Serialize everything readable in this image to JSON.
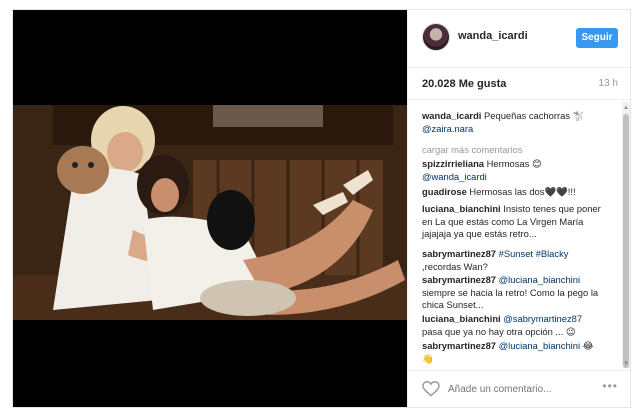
{
  "header": {
    "username": "wanda_icardi",
    "follow_label": "Seguir"
  },
  "stats": {
    "likes": "20.028 Me gusta",
    "time": "13 h"
  },
  "caption": {
    "username": "wanda_icardi",
    "text": " Pequeñas cachorras ",
    "emoji": "🐩",
    "mention": "@zaira.nara"
  },
  "load_more_label": "cargar más comentarios",
  "comments": [
    {
      "user": "spizzirrieliana",
      "text": " Hermosas 😊 ",
      "mention": "@wanda_icardi",
      "tail": ""
    },
    {
      "user": "guadirose",
      "text": " Hermosas las dos🖤🖤!!!",
      "mention": "",
      "tail": ""
    },
    {
      "user": "luciana_bianchini",
      "text": " Insisto tenes que poner en La que estás como La Virgen María jajajaja ya que estás retro...",
      "mention": "",
      "tail": ""
    },
    {
      "user": "sabrymartinez87",
      "text": " ",
      "mention": "#Sunset #Blacky",
      "tail": " ,recordas Wan?"
    },
    {
      "user": "sabrymartinez87",
      "text": " ",
      "mention": "@luciana_bianchini",
      "tail": " siempre se hacia la retro! Como la pego la chica Sunset..."
    },
    {
      "user": "luciana_bianchini",
      "text": " ",
      "mention": "@sabrymartinez87",
      "tail": " pasa que ya no hay otra opción ... 😉"
    },
    {
      "user": "sabrymartinez87",
      "text": " ",
      "mention": "@luciana_bianchini",
      "tail": " 😂👋"
    }
  ],
  "footer": {
    "comment_placeholder": "Añade un comentario...",
    "more_label": "•••"
  },
  "colors": {
    "follow_button": "#3897f0",
    "mention": "#003569",
    "muted": "#999999"
  },
  "icons": [
    "heart-icon",
    "more-options-icon"
  ]
}
